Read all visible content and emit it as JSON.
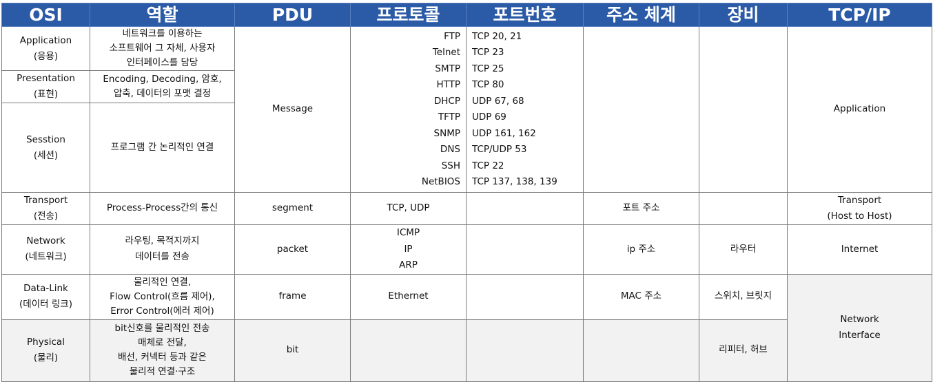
{
  "headers": {
    "osi": "OSI",
    "role": "역할",
    "pdu": "PDU",
    "protocol": "프로토콜",
    "port": "포트번호",
    "address": "주소 체계",
    "device": "장비",
    "tcpip": "TCP/IP"
  },
  "rows": {
    "application": {
      "osi_en": "Application",
      "osi_ko": "(응용)",
      "role": [
        "네트워크를 이용하는",
        "소프트웨어 그 자체, 사용자",
        "인터페이스를 담당"
      ]
    },
    "presentation": {
      "osi_en": "Presentation",
      "osi_ko": "(표현)",
      "role": [
        "Encoding, Decoding, 암호,",
        "압축, 데이터의 포맷 결정"
      ]
    },
    "session": {
      "osi_en": "Sesstion",
      "osi_ko": "(세션)",
      "role": [
        "프로그램 간 논리적인 연결"
      ]
    },
    "upper_pdu": "Message",
    "upper_tcpip": "Application",
    "protocols": [
      {
        "name": "FTP",
        "port": "TCP 20, 21"
      },
      {
        "name": "Telnet",
        "port": "TCP 23"
      },
      {
        "name": "SMTP",
        "port": "TCP 25"
      },
      {
        "name": "HTTP",
        "port": "TCP 80"
      },
      {
        "name": "DHCP",
        "port": "UDP 67, 68"
      },
      {
        "name": "TFTP",
        "port": "UDP 69"
      },
      {
        "name": "SNMP",
        "port": "UDP 161, 162"
      },
      {
        "name": "DNS",
        "port": "TCP/UDP 53"
      },
      {
        "name": "SSH",
        "port": "TCP 22"
      },
      {
        "name": "NetBIOS",
        "port": "TCP 137, 138, 139"
      }
    ],
    "transport": {
      "osi_en": "Transport",
      "osi_ko": "(전송)",
      "role": "Process-Process간의 통신",
      "pdu": "segment",
      "protocol": "TCP, UDP",
      "address": "포트 주소",
      "tcpip": [
        "Transport",
        "(Host to Host)"
      ]
    },
    "network": {
      "osi_en": "Network",
      "osi_ko": "(네트워크)",
      "role": [
        "라우팅, 목적지까지",
        "데이터를 전송"
      ],
      "pdu": "packet",
      "protocols": [
        "ICMP",
        "IP",
        "ARP"
      ],
      "address": "ip 주소",
      "device": "라우터",
      "tcpip": "Internet"
    },
    "datalink": {
      "osi_en": "Data-Link",
      "osi_ko": "(데이터 링크)",
      "role": [
        "물리적인 연결,",
        "Flow Control(흐름 제어),",
        "Error Control(에러 제어)"
      ],
      "pdu": "frame",
      "protocol": "Ethernet",
      "address": "MAC 주소",
      "device": "스위치, 브릿지"
    },
    "physical": {
      "osi_en": "Physical",
      "osi_ko": "(물리)",
      "role": [
        "bit신호를 물리적인 전송",
        "매체로 전달,",
        "배선, 커넥터 등과 같은",
        "물리적 연결·구조"
      ],
      "pdu": "bit",
      "device": "리피터, 허브"
    },
    "lower_tcpip": [
      "Network",
      "Interface"
    ]
  }
}
